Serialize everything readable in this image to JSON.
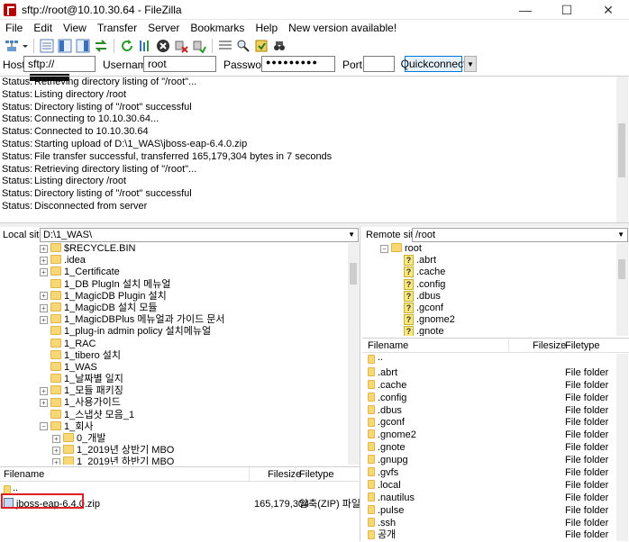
{
  "window": {
    "title": "sftp://root@10.10.30.64 - FileZilla"
  },
  "menu": [
    "File",
    "Edit",
    "View",
    "Transfer",
    "Server",
    "Bookmarks",
    "Help",
    "New version available!"
  ],
  "quickconnect": {
    "host_label": "Host:",
    "host_value": "sftp://",
    "username_label": "Username:",
    "username_value": "root",
    "password_label": "Password:",
    "password_value": "●●●●●●●●●",
    "port_label": "Port:",
    "port_value": "",
    "button_label": "Quickconnect"
  },
  "log": [
    {
      "status": "Status:",
      "message": "Retrieving directory listing of \"/root\"..."
    },
    {
      "status": "Status:",
      "message": "Listing directory /root"
    },
    {
      "status": "Status:",
      "message": "Directory listing of \"/root\" successful"
    },
    {
      "status": "Status:",
      "message": "Connecting to 10.10.30.64..."
    },
    {
      "status": "Status:",
      "message": "Connected to 10.10.30.64"
    },
    {
      "status": "Status:",
      "message": "Starting upload of D:\\1_WAS\\jboss-eap-6.4.0.zip"
    },
    {
      "status": "Status:",
      "message": "File transfer successful, transferred 165,179,304 bytes in 7 seconds"
    },
    {
      "status": "Status:",
      "message": "Retrieving directory listing of \"/root\"..."
    },
    {
      "status": "Status:",
      "message": "Listing directory /root"
    },
    {
      "status": "Status:",
      "message": "Directory listing of \"/root\" successful"
    },
    {
      "status": "Status:",
      "message": "Disconnected from server"
    }
  ],
  "local": {
    "site_label": "Local site:",
    "site_value": "D:\\1_WAS\\",
    "tree": [
      {
        "name": "$RECYCLE.BIN",
        "expander": "+"
      },
      {
        "name": ".idea",
        "expander": "+"
      },
      {
        "name": "1_Certificate",
        "expander": "+"
      },
      {
        "name": "1_DB PlugIn 설치 메뉴얼",
        "expander": ""
      },
      {
        "name": "1_MagicDB Plugin 설치",
        "expander": "+"
      },
      {
        "name": "1_MagicDB 설치 모듈",
        "expander": "+"
      },
      {
        "name": "1_MagicDBPlus 메뉴얼과 가이드 문서",
        "expander": "+"
      },
      {
        "name": "1_plug-in admin policy 설치메뉴얼",
        "expander": ""
      },
      {
        "name": "1_RAC",
        "expander": ""
      },
      {
        "name": "1_tibero 설치",
        "expander": ""
      },
      {
        "name": "1_WAS",
        "expander": ""
      },
      {
        "name": "1_날짜별 일지",
        "expander": ""
      },
      {
        "name": "1_모듈 패키징",
        "expander": "+"
      },
      {
        "name": "1_사용가이드",
        "expander": "+"
      },
      {
        "name": "1_스냅샷 모음_1",
        "expander": ""
      },
      {
        "name": "1_회사",
        "expander": "−"
      },
      {
        "name": "0_개발",
        "expander": "+",
        "sub": true
      },
      {
        "name": "1_2019년 상반기 MBO",
        "expander": "+",
        "sub": true
      },
      {
        "name": "1_2019년 하반기 MBO",
        "expander": "+",
        "sub": true
      }
    ],
    "columns": {
      "filename": "Filename",
      "filesize": "Filesize",
      "filetype": "Filetype"
    },
    "files": [
      {
        "name": "..",
        "size": "",
        "type": ""
      },
      {
        "name": "jboss-eap-6.4.0.zip",
        "size": "165,179,304",
        "type": "압축(ZIP) 파일"
      }
    ]
  },
  "remote": {
    "site_label": "Remote site:",
    "site_value": "/root",
    "tree_root": "root",
    "tree": [
      ".abrt",
      ".cache",
      ".config",
      ".dbus",
      ".gconf",
      ".gnome2",
      ".gnote"
    ],
    "columns": {
      "filename": "Filename",
      "filesize": "Filesize",
      "filetype": "Filetype"
    },
    "files": [
      {
        "name": "..",
        "type": ""
      },
      {
        "name": ".abrt",
        "type": "File folder"
      },
      {
        "name": ".cache",
        "type": "File folder"
      },
      {
        "name": ".config",
        "type": "File folder"
      },
      {
        "name": ".dbus",
        "type": "File folder"
      },
      {
        "name": ".gconf",
        "type": "File folder"
      },
      {
        "name": ".gnome2",
        "type": "File folder"
      },
      {
        "name": ".gnote",
        "type": "File folder"
      },
      {
        "name": ".gnupg",
        "type": "File folder"
      },
      {
        "name": ".gvfs",
        "type": "File folder"
      },
      {
        "name": ".local",
        "type": "File folder"
      },
      {
        "name": ".nautilus",
        "type": "File folder"
      },
      {
        "name": ".pulse",
        "type": "File folder"
      },
      {
        "name": ".ssh",
        "type": "File folder"
      },
      {
        "name": "공개",
        "type": "File folder"
      }
    ]
  }
}
